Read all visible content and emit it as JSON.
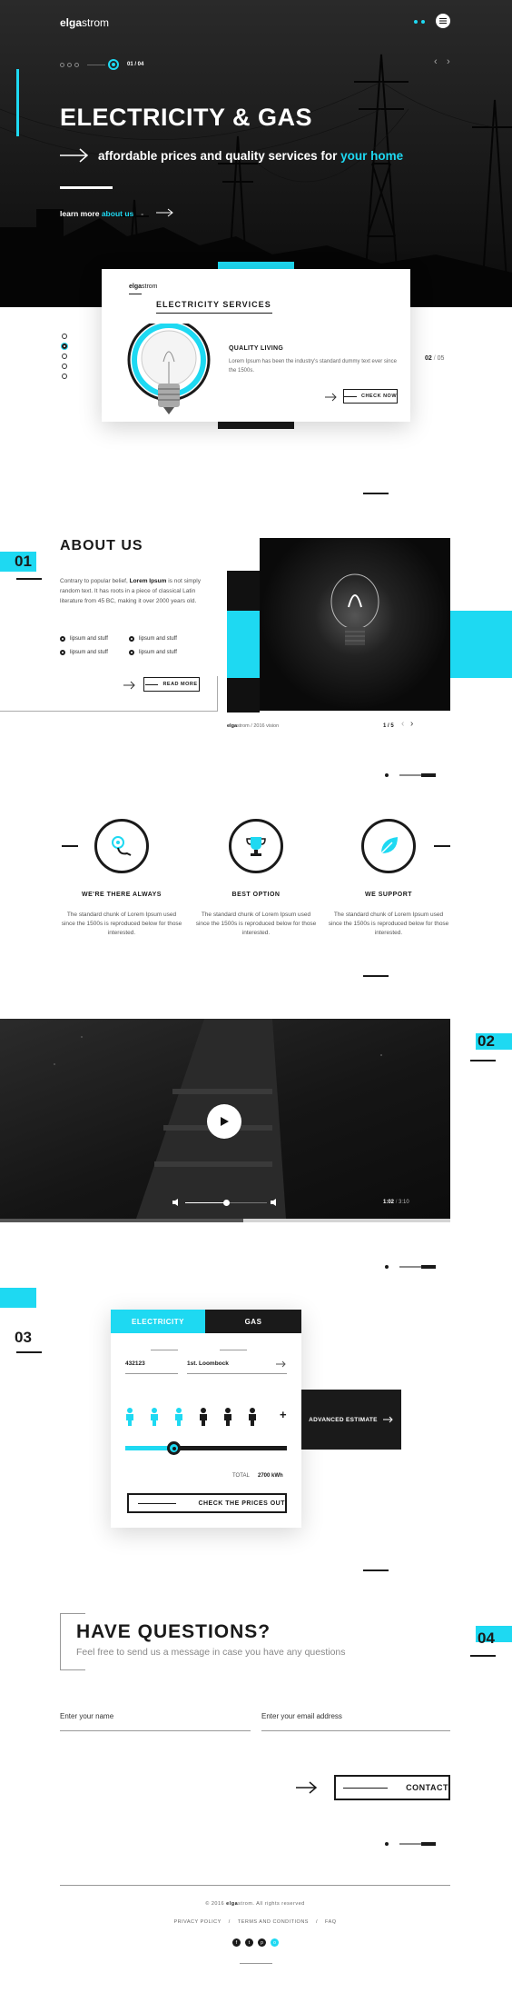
{
  "brand": {
    "bold": "elga",
    "light": "strom"
  },
  "hero": {
    "title": "ELECTRICITY & GAS",
    "subtitle_a": "affordable prices and quality services for ",
    "subtitle_b": "your home",
    "learn_a": "learn more ",
    "learn_b": "about us",
    "counter": "01 / 04"
  },
  "services": {
    "card_title": "ELECTRICITY SERVICES",
    "item_title": "QUALITY LIVING",
    "item_text": "Lorem Ipsum has been the industry's standard dummy text ever since the 1500s.",
    "check_label": "CHECK NOW",
    "counter_current": "02",
    "counter_sep": "/",
    "counter_total": "05"
  },
  "about": {
    "num": "01",
    "title": "ABOUT US",
    "text_a": "Contrary to popular belief, ",
    "text_bold": "Lorem Ipsum",
    "text_b": " is not simply random text. It has roots in a piece of classical Latin literature from 45 BC, making it over 2000 years old.",
    "bullets": [
      "lipsum and stuff",
      "lipsum and stuff",
      "lipsum and stuff",
      "lipsum and stuff"
    ],
    "read_more": "READ MORE",
    "caption_bold": "elga",
    "caption_rest": "strom / 2016 vision",
    "gallery_counter": "1 / 5"
  },
  "features": [
    {
      "title": "WE'RE THERE ALWAYS",
      "text": "The standard chunk of Lorem Ipsum used since the 1500s is reproduced below for those interested.",
      "icon": "location-route-icon"
    },
    {
      "title": "BEST OPTION",
      "text": "The standard chunk of Lorem Ipsum used since the 1500s is reproduced below for those interested.",
      "icon": "trophy-icon"
    },
    {
      "title": "WE SUPPORT",
      "text": "The standard chunk of Lorem Ipsum used since the 1500s is reproduced below for those interested.",
      "icon": "leaf-icon"
    }
  ],
  "video": {
    "num": "02",
    "time_current": "1:02",
    "time_sep": "/",
    "time_total": "3:10",
    "progress": 0.54,
    "volume": 0.5
  },
  "calculator": {
    "num": "03",
    "tabs": [
      "ELECTRICITY",
      "GAS"
    ],
    "postcode": "432123",
    "address": "1st. Loombock",
    "people_total": 6,
    "people_selected": 3,
    "slider_value": 0.3,
    "total_label": "TOTAL",
    "total_value": "2700 kWh",
    "check_prices": "CHECK THE PRICES OUT",
    "advanced": "ADVANCED ESTIMATE"
  },
  "contact": {
    "num": "04",
    "title": "HAVE QUESTIONS?",
    "subtitle": "Feel free to send us a message in case you have any questions",
    "name_placeholder": "Enter your name",
    "email_placeholder": "Enter your email address",
    "button": "CONTACT"
  },
  "footer": {
    "copy_a": "© 2016 ",
    "copy_bold": "elga",
    "copy_b": "strom. All rights reserved",
    "links": [
      "PRIVACY POLICY",
      "TERMS AND CONDITIONS",
      "FAQ"
    ],
    "sep": "/"
  },
  "colors": {
    "accent": "#1ed9f2",
    "dark": "#1a1a1a"
  }
}
